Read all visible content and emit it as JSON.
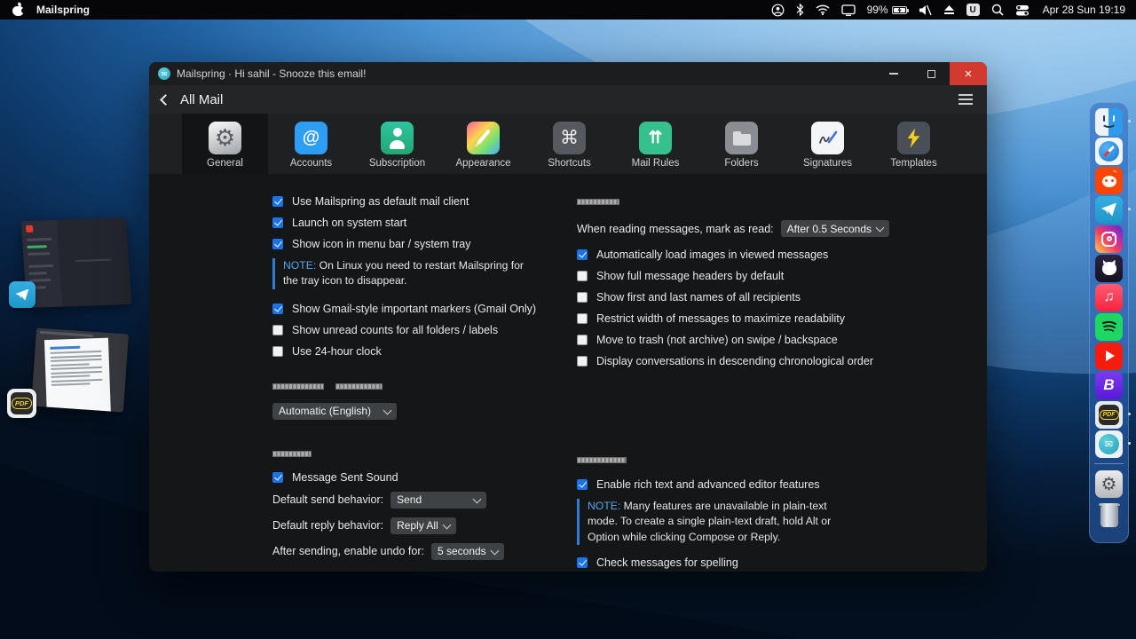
{
  "menu_bar": {
    "app_name": "Mailspring",
    "battery_percent": "99%",
    "keyboard_layout": "U",
    "clock": "Apr 28 Sun 19:19",
    "status_icons": [
      "user-account",
      "bluetooth",
      "wifi",
      "display",
      "battery-charging",
      "volume-muted",
      "eject",
      "keyboard-layout",
      "search",
      "control-center"
    ]
  },
  "window": {
    "title": "Mailspring · Hi sahil - Snooze this email!",
    "controls": {
      "minimize": "–",
      "maximize": "□",
      "close": "×"
    },
    "nav": {
      "back_label": "All Mail"
    },
    "tabs": [
      {
        "label": "General",
        "icon": "gear",
        "active": true
      },
      {
        "label": "Accounts",
        "icon": "at-sign",
        "active": false
      },
      {
        "label": "Subscription",
        "icon": "person",
        "active": false
      },
      {
        "label": "Appearance",
        "icon": "paintbrush",
        "active": false
      },
      {
        "label": "Shortcuts",
        "icon": "command-key",
        "active": false
      },
      {
        "label": "Mail Rules",
        "icon": "split-arrows",
        "active": false
      },
      {
        "label": "Folders",
        "icon": "folder",
        "active": false
      },
      {
        "label": "Signatures",
        "icon": "signature-pen",
        "active": false
      },
      {
        "label": "Templates",
        "icon": "lightning-arrow",
        "active": false
      }
    ]
  },
  "prefs": {
    "left": {
      "checks1": [
        {
          "label": "Use Mailspring as default mail client",
          "checked": true
        },
        {
          "label": "Launch on system start",
          "checked": true
        },
        {
          "label": "Show icon in menu bar / system tray",
          "checked": true
        }
      ],
      "note_prefix": "NOTE:",
      "note_text": " On Linux you need to restart Mailspring for the tray icon to disappear.",
      "checks2": [
        {
          "label": "Show Gmail-style important markers (Gmail Only)",
          "checked": true
        },
        {
          "label": "Show unread counts for all folders / labels",
          "checked": false
        },
        {
          "label": "Use 24-hour clock",
          "checked": false
        }
      ],
      "language_value": "Automatic (English)",
      "sending_check": {
        "label": "Message Sent Sound",
        "checked": true
      },
      "sending_rows": [
        {
          "label": "Default send behavior:",
          "value": "Send"
        },
        {
          "label": "Default reply behavior:",
          "value": "Reply All"
        },
        {
          "label": "After sending, enable undo for:",
          "value": "5 seconds"
        }
      ]
    },
    "right": {
      "reading_row": {
        "label": "When reading messages, mark as read:",
        "value": "After 0.5 Seconds"
      },
      "reading_checks": [
        {
          "label": "Automatically load images in viewed messages",
          "checked": true
        },
        {
          "label": "Show full message headers by default",
          "checked": false
        },
        {
          "label": "Show first and last names of all recipients",
          "checked": false
        },
        {
          "label": "Restrict width of messages to maximize readability",
          "checked": false
        },
        {
          "label": "Move to trash (not archive) on swipe / backspace",
          "checked": false
        },
        {
          "label": "Display conversations in descending chronological order",
          "checked": false
        }
      ],
      "composing_check1": {
        "label": "Enable rich text and advanced editor features",
        "checked": true
      },
      "composing_note_prefix": "NOTE:",
      "composing_note_text": " Many features are unavailable in plain-text mode. To create a single plain-text draft, hold Alt or Option while clicking Compose or Reply.",
      "composing_check2": {
        "label": "Check messages for spelling",
        "checked": true
      }
    }
  },
  "dock": {
    "items": [
      "finder",
      "safari",
      "reddit",
      "telegram",
      "instagram",
      "github",
      "apple-music",
      "spotify",
      "youtube",
      "b-app",
      "pdf-reader",
      "mailspring",
      "system-settings",
      "trash"
    ],
    "running_indicators": [
      "finder",
      "telegram",
      "pdf-reader",
      "mailspring"
    ]
  },
  "colors": {
    "checkbox_accent": "#1a73e8",
    "note_accent": "#2e7cd6",
    "close_button": "#d33a2f",
    "dock_tint": "rgba(45,104,190,0.55)",
    "window_bg": "#141617"
  }
}
